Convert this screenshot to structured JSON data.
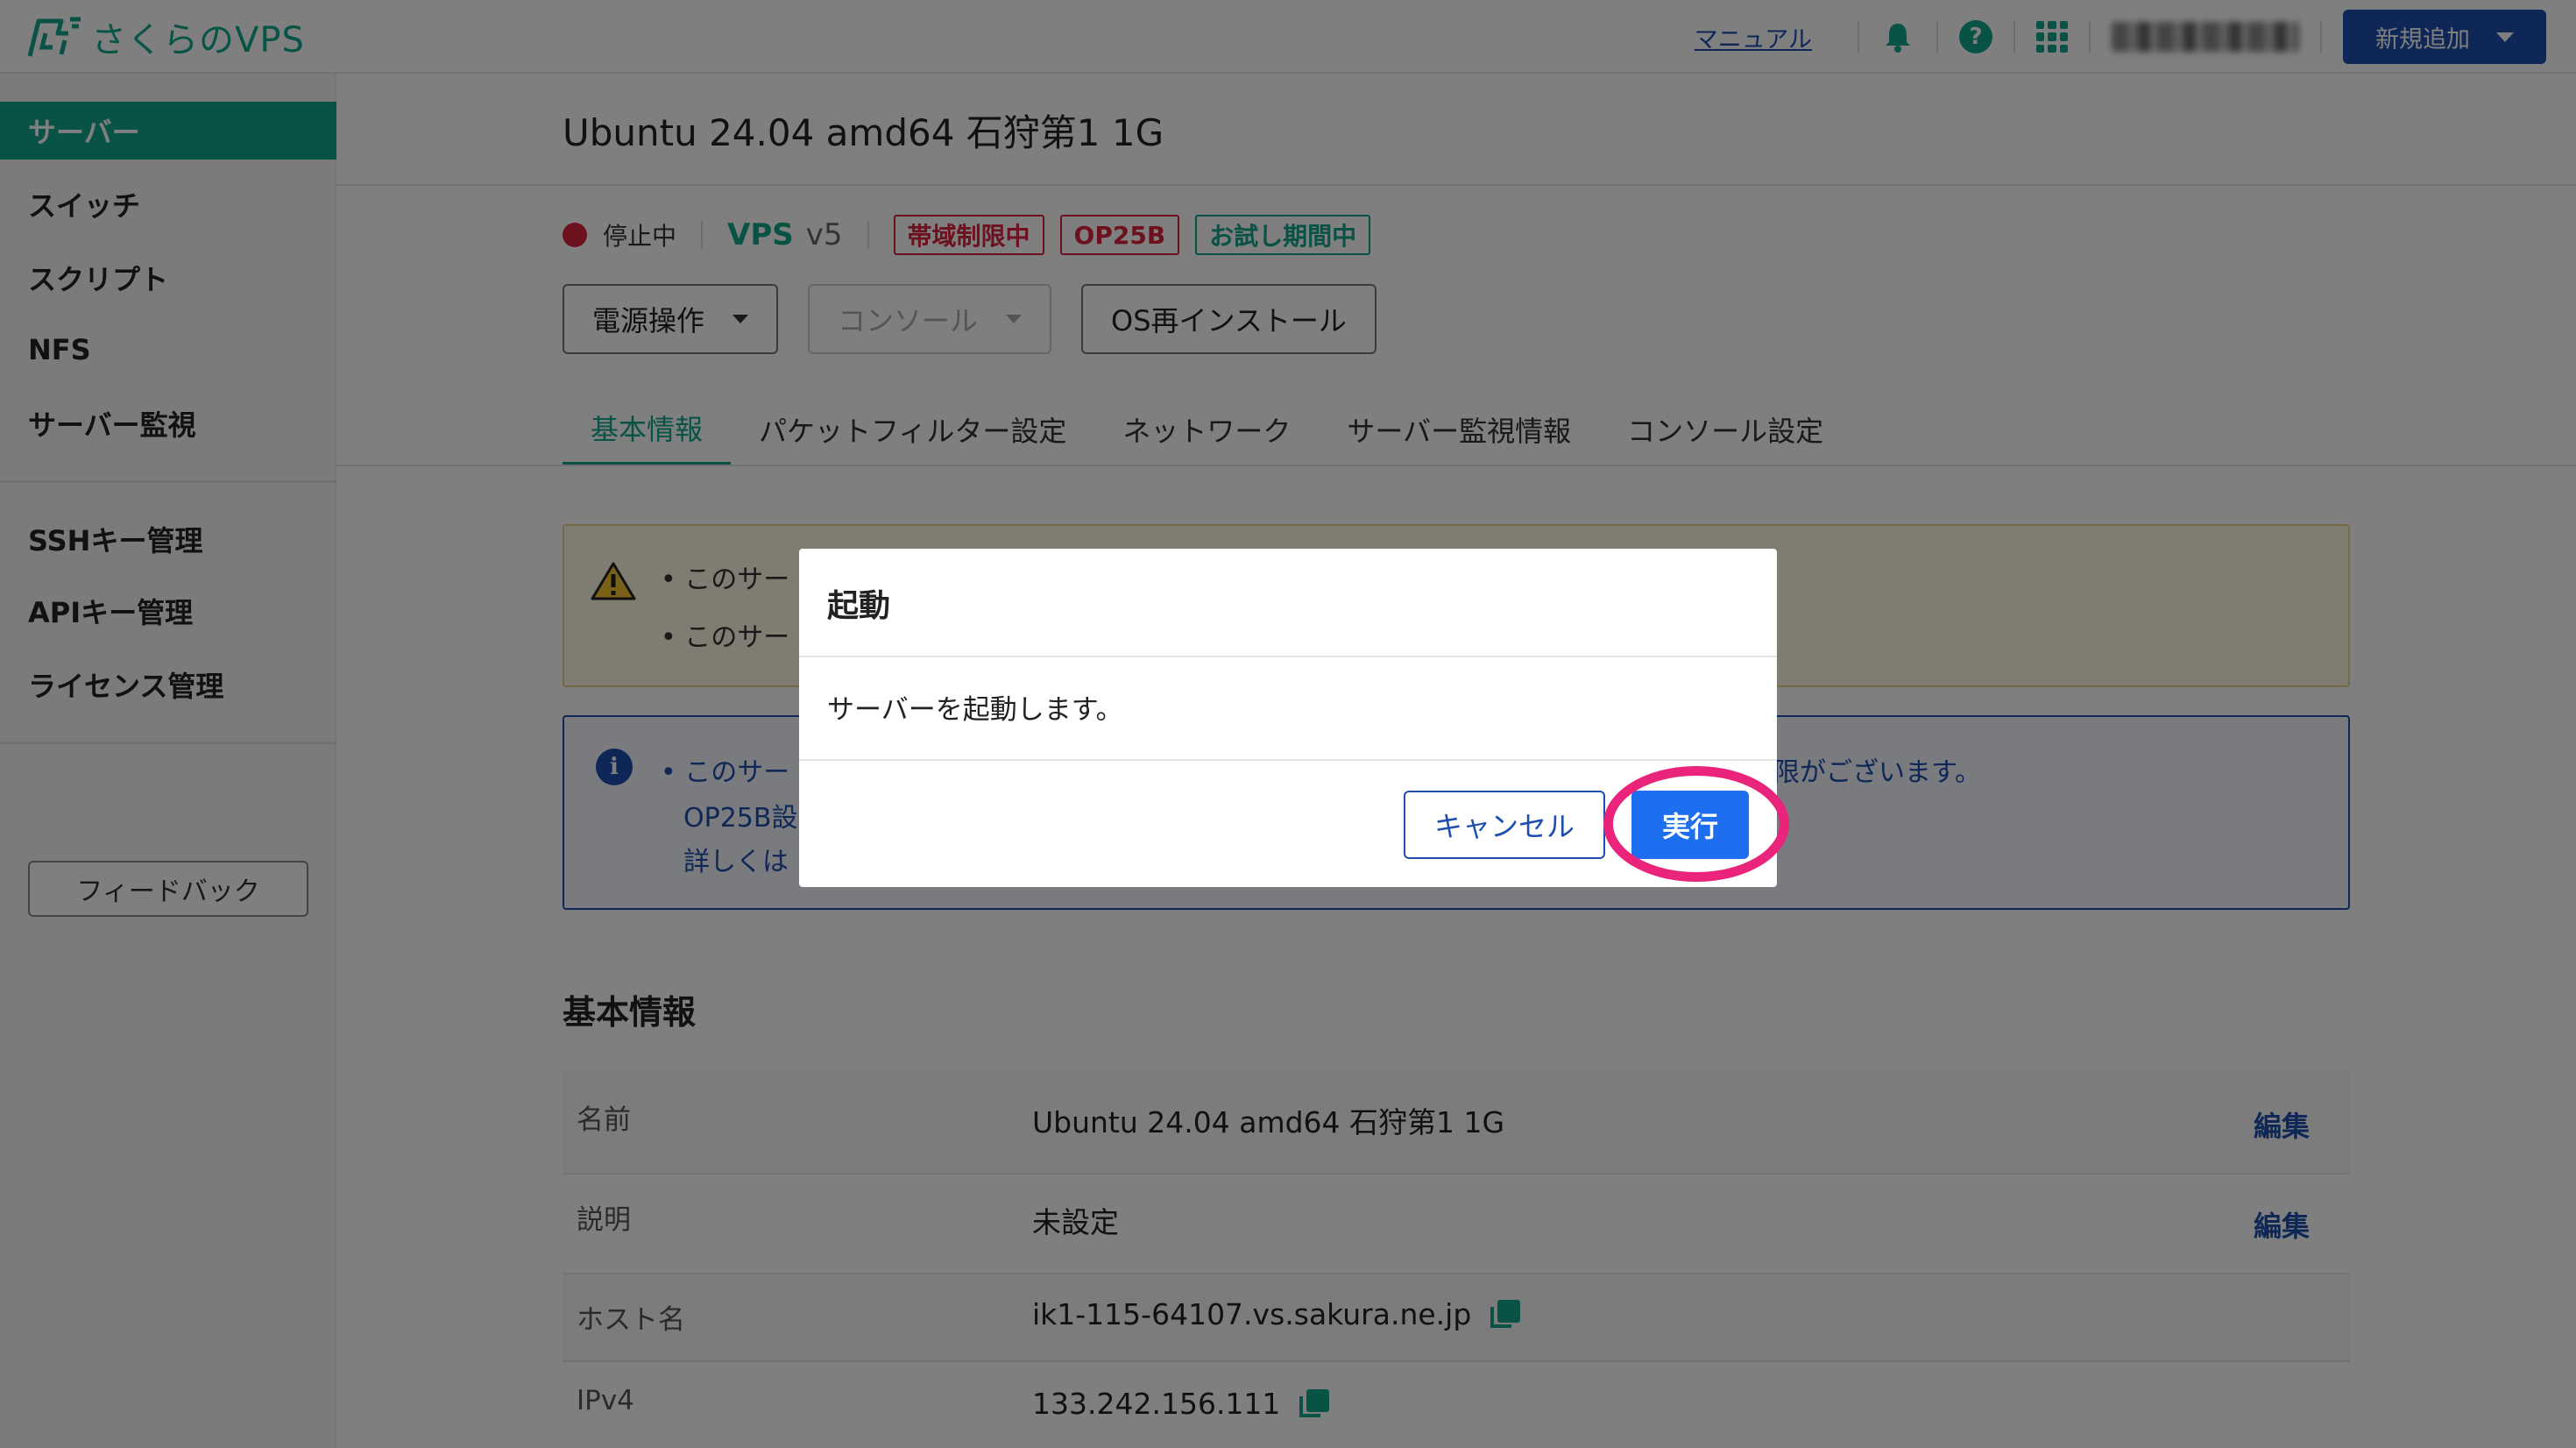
{
  "header": {
    "logo_text": "さくらのVPS",
    "manual_link": "マニュアル",
    "new_button": "新規追加",
    "colors": {
      "brand": "#13a48c",
      "primary": "#1f4fae"
    }
  },
  "sidebar": {
    "items": [
      {
        "label": "サーバー",
        "active": true
      },
      {
        "label": "スイッチ"
      },
      {
        "label": "スクリプト"
      },
      {
        "label": "NFS"
      },
      {
        "label": "サーバー監視"
      },
      {
        "label": "SSHキー管理"
      },
      {
        "label": "APIキー管理"
      },
      {
        "label": "ライセンス管理"
      }
    ],
    "feedback_button": "フィードバック"
  },
  "server": {
    "title": "Ubuntu 24.04 amd64 石狩第1 1G",
    "status": "停止中",
    "plan": "VPS",
    "plan_version": "v5",
    "tags": [
      "帯域制限中",
      "OP25B",
      "お試し期間中"
    ]
  },
  "actions": {
    "power": "電源操作",
    "console": "コンソール",
    "reinstall": "OS再インストール"
  },
  "tabs": [
    "基本情報",
    "パケットフィルター設定",
    "ネットワーク",
    "サーバー監視情報",
    "コンソール設定"
  ],
  "warning": {
    "lines": [
      "このサー",
      "このサー"
    ]
  },
  "notice": {
    "lines": [
      "このサー",
      "OP25B設",
      "詳しくは"
    ],
    "trailing": "限がございます。"
  },
  "basic_info": {
    "section_title": "基本情報",
    "edit_label": "編集",
    "rows": [
      {
        "label": "名前",
        "value": "Ubuntu 24.04 amd64 石狩第1 1G"
      },
      {
        "label": "説明",
        "value": "未設定"
      },
      {
        "label": "ホスト名",
        "value": "ik1-115-64107.vs.sakura.ne.jp"
      },
      {
        "label": "IPv4",
        "value": "133.242.156.111"
      }
    ]
  },
  "modal": {
    "title": "起動",
    "message": "サーバーを起動します。",
    "cancel": "キャンセル",
    "confirm": "実行"
  }
}
